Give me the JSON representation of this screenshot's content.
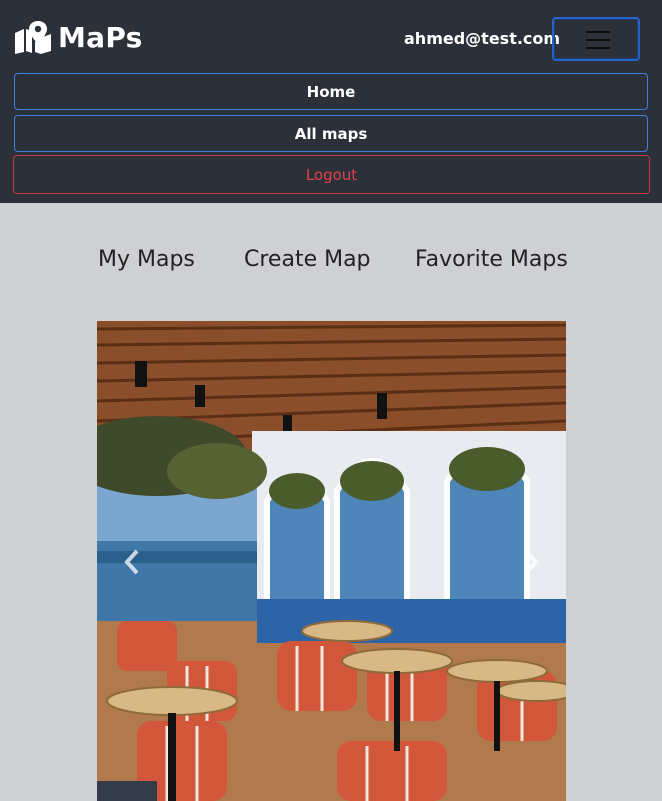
{
  "brand": {
    "name": "MaPs",
    "icon": "map-marker-icon"
  },
  "user": {
    "email": "ahmed@test.com"
  },
  "nav": {
    "home_label": "Home",
    "all_maps_label": "All maps",
    "logout_label": "Logout"
  },
  "tabs": [
    {
      "label": "My Maps"
    },
    {
      "label": "Create Map"
    },
    {
      "label": "Favorite Maps"
    }
  ],
  "carousel": {
    "prev_icon": "chevron-left-icon",
    "next_icon": "chevron-right-icon"
  },
  "colors": {
    "navbar_bg": "#2c3038",
    "page_bg": "#cfd0d3",
    "primary_border": "#3f7fe0",
    "danger": "#e0414b"
  }
}
